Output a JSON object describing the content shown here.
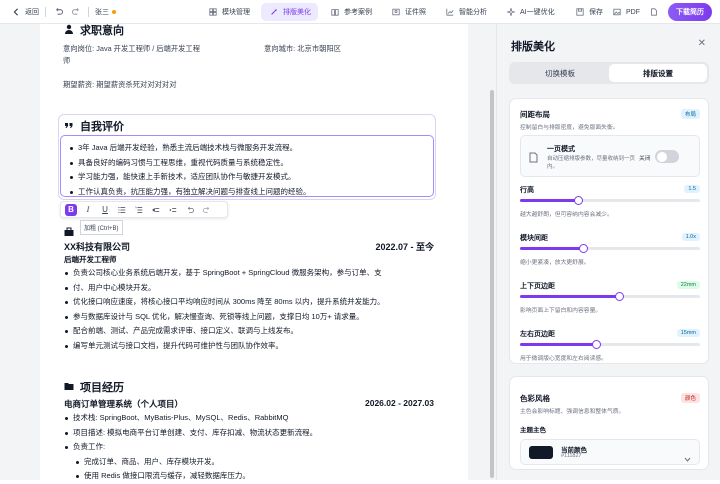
{
  "topbar": {
    "back_label": "返回",
    "doc_name": "张三",
    "tabs": [
      {
        "label": "模块管理",
        "icon": "grid-icon"
      },
      {
        "label": "排版美化",
        "icon": "magic-wand-icon"
      },
      {
        "label": "参考案例",
        "icon": "book-icon"
      },
      {
        "label": "证件照",
        "icon": "id-photo-icon"
      },
      {
        "label": "智能分析",
        "icon": "chart-icon"
      },
      {
        "label": "AI一键优化",
        "icon": "sparkle-icon"
      }
    ],
    "save_label": "保存",
    "pdf_label": "PDF",
    "download_label": "下载简历"
  },
  "resume": {
    "intent_title": "求职意向",
    "intent_position": "意向岗位: Java 开发工程师 / 后端开发工程",
    "intent_position_wrap": "师",
    "intent_city": "意向城市: 北京市朝阳区",
    "intent_salary": "期望薪资: 期望薪资杀死对对对对对",
    "eval_title": "自我评价",
    "eval_items": [
      "3年 Java 后端开发经验，熟悉主流后端技术栈与微服务开发流程。",
      "具备良好的编码习惯与工程思维，重视代码质量与系统稳定性。",
      "学习能力强，能快速上手新技术，适应团队协作与敏捷开发模式。",
      "工作认真负责，抗压能力强，有独立解决问题与排查线上问题的经验。"
    ],
    "tooltip": "加粗 (Ctrl+B)",
    "company": "XX科技有限公司",
    "company_period": "2022.07 - 至今",
    "role": "后端开发工程师",
    "work_items": [
      "负责公司核心业务系统后端开发，基于 SpringBoot + SpringCloud 微服务架构，参与订单、支",
      "付、用户中心模块开发。",
      "优化接口响应速度，将核心接口平均响应时间从 300ms 降至 80ms 以内，提升系统并发能力。",
      "参与数据库设计与 SQL 优化，解决慢查询、死锁等线上问题，支撑日均 10万+ 请求量。",
      "配合前端、测试、产品完成需求评审、接口定义、联调与上线发布。",
      "编写单元测试与接口文档，提升代码可维护性与团队协作效率。"
    ],
    "project_title": "项目经历",
    "project_name": "电商订单管理系统（个人项目）",
    "project_period": "2026.02 - 2027.03",
    "project_items": [
      {
        "text": "技术栈: SpringBoot、MyBatis-Plus、MySQL、Redis、RabbitMQ",
        "sub": false
      },
      {
        "text": "项目描述: 模拟电商平台订单创建、支付、库存扣减、物流状态更新流程。",
        "sub": false
      },
      {
        "text": "负责工作:",
        "sub": false
      },
      {
        "text": "完成订单、商品、用户、库存模块开发。",
        "sub": true
      },
      {
        "text": "使用 Redis 做接口限流与缓存，减轻数据库压力。",
        "sub": true
      }
    ]
  },
  "panel": {
    "title": "排版美化",
    "tabs": [
      "切换模板",
      "排版设置"
    ],
    "spacing_card": {
      "title": "间距布局",
      "badge": "布局",
      "desc": "控制留白与排版密度，避免版面失衡。",
      "onepage_title": "一页模式",
      "onepage_desc": "自动压缩排版参数，尽量收纳到一页内。",
      "onepage_state": "关闭",
      "sliders": [
        {
          "label": "行高",
          "value_text": "1.5",
          "desc": "越大越舒朗，但可容纳内容会减少。",
          "fraction": 0.32
        },
        {
          "label": "模块间距",
          "value_text": "1.0x",
          "desc": "缩小更紧凑，放大更舒展。",
          "fraction": 0.35
        },
        {
          "label": "上下页边距",
          "value_text": "22mm",
          "desc": "影响页面上下留白和内容容量。",
          "fraction": 0.55
        },
        {
          "label": "左右页边距",
          "value_text": "15mm",
          "desc": "用于微调版心宽度和左右阅读感。",
          "fraction": 0.42
        }
      ]
    },
    "color_card": {
      "title": "色彩风格",
      "badge": "颜色",
      "desc": "主色会影响标题、强调信息和整体气质。",
      "theme_label": "主题主色",
      "current_label": "当前颜色",
      "current_hex": "#111827"
    }
  },
  "colors": {
    "accent": "#7c3aed",
    "theme": "#111827"
  }
}
